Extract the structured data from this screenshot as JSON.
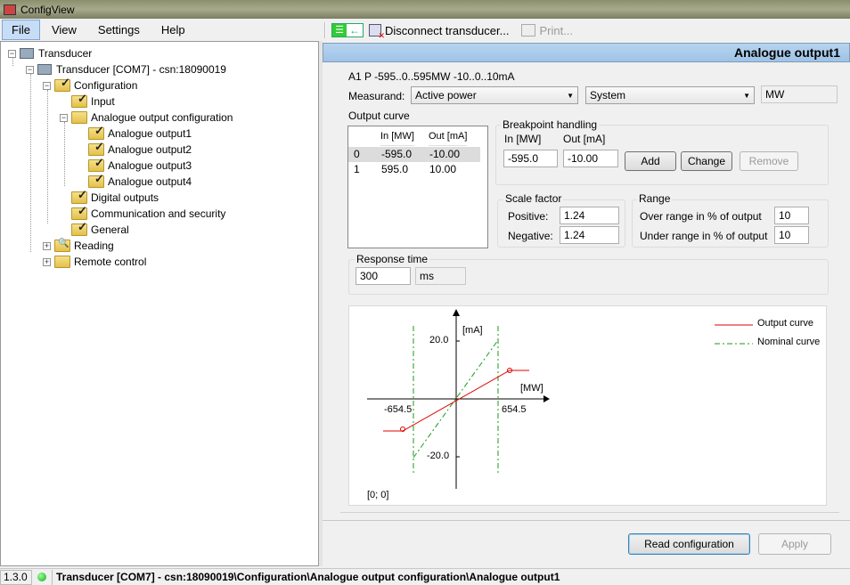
{
  "window": {
    "title": "ConfigView"
  },
  "menu": {
    "file": "File",
    "view": "View",
    "settings": "Settings",
    "help": "Help"
  },
  "toolbar": {
    "disconnect": "Disconnect transducer...",
    "print": "Print..."
  },
  "tree": {
    "root": "Transducer",
    "device": "Transducer [COM7] - csn:18090019",
    "configuration": "Configuration",
    "input": "Input",
    "aoc": "Analogue output configuration",
    "ao1": "Analogue output1",
    "ao2": "Analogue output2",
    "ao3": "Analogue output3",
    "ao4": "Analogue output4",
    "digital": "Digital outputs",
    "comm": "Communication and security",
    "general": "General",
    "reading": "Reading",
    "remote": "Remote control"
  },
  "panel": {
    "title": "Analogue output1",
    "summary": "A1 P -595..0..595MW -10..0..10mA",
    "measurand_label": "Measurand:",
    "measurand_value": "Active power",
    "system_value": "System",
    "unit": "MW",
    "output_curve_label": "Output curve",
    "grid": {
      "col_in": "In [MW]",
      "col_out": "Out [mA]",
      "rows": [
        {
          "idx": "0",
          "in": "-595.0",
          "out": "-10.00"
        },
        {
          "idx": "1",
          "in": "595.0",
          "out": "10.00"
        }
      ]
    },
    "breakpoint": {
      "label": "Breakpoint handling",
      "in_label": "In [MW]",
      "out_label": "Out [mA]",
      "in_value": "-595.0",
      "out_value": "-10.00",
      "add": "Add",
      "change": "Change",
      "remove": "Remove"
    },
    "scale": {
      "label": "Scale factor",
      "positive_label": "Positive:",
      "positive": "1.24",
      "negative_label": "Negative:",
      "negative": "1.24"
    },
    "range": {
      "label": "Range",
      "over_label": "Over range in % of output",
      "over": "10",
      "under_label": "Under range in % of output",
      "under": "10"
    },
    "response": {
      "label": "Response time",
      "value": "300",
      "unit": "ms"
    },
    "graph": {
      "y_unit": "[mA]",
      "x_unit": "[MW]",
      "y_pos": "20.0",
      "y_neg": "-20.0",
      "x_neg": "-654.5",
      "x_pos": "654.5",
      "origin": "[0; 0]",
      "legend_output": "Output curve",
      "legend_nominal": "Nominal curve",
      "color_output": "#e00000",
      "color_nominal": "#1a9a1a"
    },
    "read_config": "Read configuration",
    "apply": "Apply"
  },
  "status": {
    "version": "1.3.0",
    "path": "Transducer [COM7] - csn:18090019\\Configuration\\Analogue output configuration\\Analogue output1"
  }
}
